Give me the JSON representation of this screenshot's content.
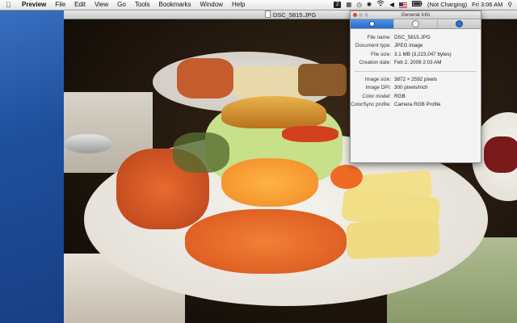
{
  "menubar": {
    "app": "Preview",
    "menus": [
      "File",
      "Edit",
      "View",
      "Go",
      "Tools",
      "Bookmarks",
      "Window",
      "Help"
    ],
    "battery_status": "(Not Charging)",
    "clock": "Fri 3:06 AM",
    "status_badge": "2"
  },
  "window": {
    "title": "DSC_5815.JPG"
  },
  "inspector": {
    "title": "General Info",
    "tabs": [
      "info-tab",
      "keywords-tab",
      "search-tab"
    ],
    "info": [
      {
        "label": "File name:",
        "value": "DSC_5815.JPG"
      },
      {
        "label": "Document type:",
        "value": "JPEG image"
      },
      {
        "label": "File size:",
        "value": "3.1 MB (3,223,047 bytes)"
      },
      {
        "label": "Creation date:",
        "value": "Feb 2, 2009 2:03 AM"
      }
    ],
    "image": [
      {
        "label": "Image size:",
        "value": "3872 × 2592 pixels"
      },
      {
        "label": "Image DPI:",
        "value": "300 pixels/inch"
      },
      {
        "label": "Color model:",
        "value": "RGB"
      },
      {
        "label": "ColorSync profile:",
        "value": "Camera RGB Profile"
      }
    ]
  },
  "colors": {
    "desktop": "#23519a",
    "accent_tab": "#2a68c7"
  }
}
